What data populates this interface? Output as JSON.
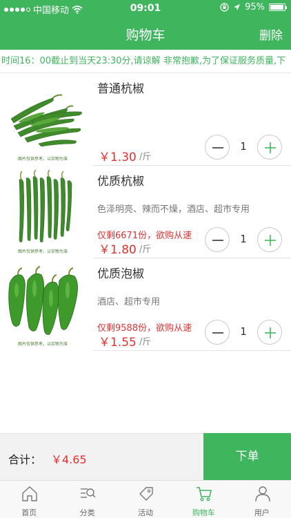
{
  "status_bar": {
    "carrier": "中国移动",
    "time": "09:01",
    "battery": "95%",
    "battery_level": 0.95
  },
  "header": {
    "title": "购物车",
    "delete_label": "删除"
  },
  "notice": {
    "text": "时间16：00截止到当天23:30分,请谅解 非常抱歉,为了保证服务质量,下"
  },
  "items": [
    {
      "name": "普通杭椒",
      "desc": "",
      "stock": "",
      "price": "￥1.30",
      "unit": "/斤",
      "qty": "1",
      "image_caption": "图片仅供参考，以实物为准",
      "image_icon": "green-peppers-image"
    },
    {
      "name": "优质杭椒",
      "desc": "色泽明亮、辣而不燥，酒店、超市专用",
      "stock": "仅剩6671份，欲购从速",
      "price": "￥1.80",
      "unit": "/斤",
      "qty": "1",
      "image_caption": "图片仅供参考，以实物为准",
      "image_icon": "long-peppers-image"
    },
    {
      "name": "优质泡椒",
      "desc": "酒店、超市专用",
      "stock": "仅剩9588份，欲购从速",
      "price": "￥1.55",
      "unit": "/斤",
      "qty": "1",
      "image_caption": "图片仅供参考，以实物为准",
      "image_icon": "bell-peppers-image"
    }
  ],
  "footer": {
    "total_label": "合计：",
    "total_value": "￥4.65",
    "order_label": "下单"
  },
  "tabs": [
    {
      "label": "首页",
      "icon": "home-icon"
    },
    {
      "label": "分类",
      "icon": "category-search-icon"
    },
    {
      "label": "活动",
      "icon": "tag-icon"
    },
    {
      "label": "购物车",
      "icon": "cart-icon",
      "active": true
    },
    {
      "label": "用户",
      "icon": "user-icon"
    }
  ],
  "colors": {
    "brand_green": "#3fb55e",
    "price_red": "#e03131"
  }
}
